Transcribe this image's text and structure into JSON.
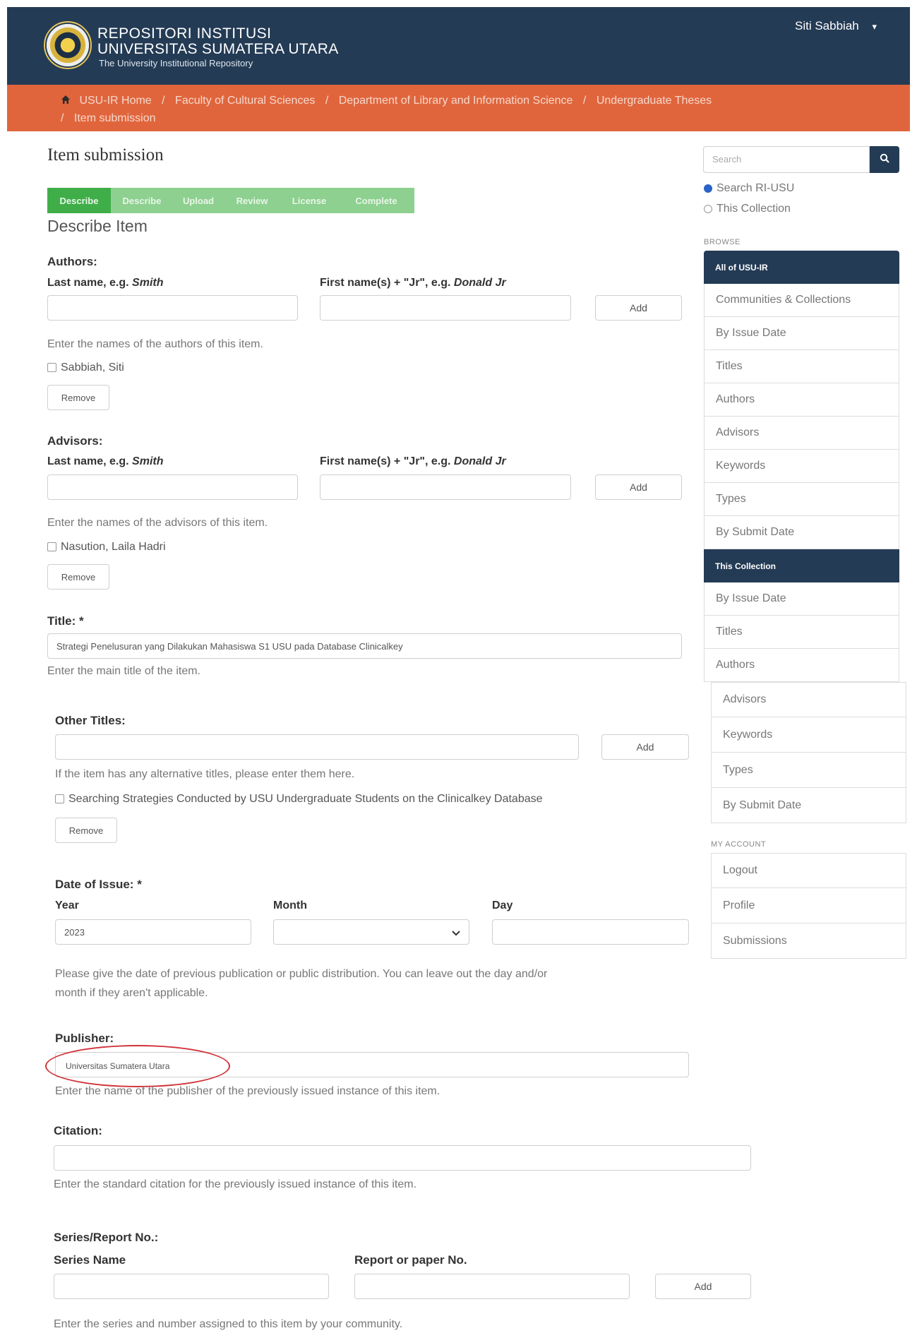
{
  "header": {
    "brand_line1": "REPOSITORI INSTITUSI",
    "brand_line2": "UNIVERSITAS SUMATERA UTARA",
    "brand_line3": "The University Institutional Repository",
    "user_name": "Siti Sabbiah",
    "user_caret": "▾"
  },
  "breadcrumb": {
    "items": [
      "USU-IR Home",
      "Faculty of Cultural Sciences",
      "Department of Library and Information Science",
      "Undergraduate Theses",
      "Item submission"
    ],
    "separator": "/"
  },
  "page": {
    "title": "Item submission",
    "section_title": "Describe Item"
  },
  "progress": {
    "steps": [
      "Describe",
      "Describe",
      "Upload",
      "Review",
      "License",
      "Complete"
    ],
    "colors": {
      "active": "#3fae49",
      "inactive": "#8dd08f"
    }
  },
  "authors": {
    "label": "Authors:",
    "last_label": "Last name, e.g.",
    "last_example": "Smith",
    "first_label": "First name(s) + \"Jr\", e.g.",
    "first_example": "Donald Jr",
    "add_label": "Add",
    "help": "Enter the names of the authors of this item.",
    "entry": "Sabbiah, Siti",
    "remove_label": "Remove"
  },
  "advisors": {
    "label": "Advisors:",
    "last_label": "Last name, e.g.",
    "last_example": "Smith",
    "first_label": "First name(s) + \"Jr\", e.g.",
    "first_example": "Donald Jr",
    "add_label": "Add",
    "help": "Enter the names of the advisors of this item.",
    "entry": "Nasution, Laila Hadri",
    "remove_label": "Remove"
  },
  "title_field": {
    "label": "Title: *",
    "value": "Strategi Penelusuran yang Dilakukan Mahasiswa S1 USU pada Database Clinicalkey",
    "help": "Enter the main title of the item."
  },
  "other_titles": {
    "label": "Other Titles:",
    "add_label": "Add",
    "help": "If the item has any alternative titles, please enter them here.",
    "entry": "Searching Strategies Conducted by USU Undergraduate Students on the Clinicalkey Database",
    "remove_label": "Remove"
  },
  "date_issue": {
    "label": "Date of Issue: *",
    "year_label": "Year",
    "month_label": "Month",
    "day_label": "Day",
    "year_value": "2023",
    "help_line1": "Please give the date of previous publication or public distribution. You can leave out the day and/or",
    "help_line2": "month if they aren't applicable."
  },
  "publisher": {
    "label": "Publisher:",
    "value": "Universitas Sumatera Utara",
    "help": "Enter the name of the publisher of the previously issued instance of this item."
  },
  "citation": {
    "label": "Citation:",
    "help": "Enter the standard citation for the previously issued instance of this item."
  },
  "series": {
    "label": "Series/Report No.:",
    "name_label": "Series Name",
    "number_label": "Report or paper No.",
    "add_label": "Add",
    "help": "Enter the series and number assigned to this item by your community."
  },
  "sidebar": {
    "search_placeholder": "Search",
    "scope_all": "Search RI-USU",
    "scope_collection": "This Collection",
    "browse_label": "BROWSE",
    "all_header": "All of USU-IR",
    "all_items": [
      "Communities & Collections",
      "By Issue Date",
      "Titles",
      "Authors",
      "Advisors",
      "Keywords",
      "Types",
      "By Submit Date"
    ],
    "collection_header": "This Collection",
    "collection_items": [
      "By Issue Date",
      "Titles",
      "Authors",
      "Advisors",
      "Keywords",
      "Types",
      "By Submit Date"
    ],
    "account_label": "MY ACCOUNT",
    "account_items": [
      "Logout",
      "Profile",
      "Submissions"
    ]
  }
}
